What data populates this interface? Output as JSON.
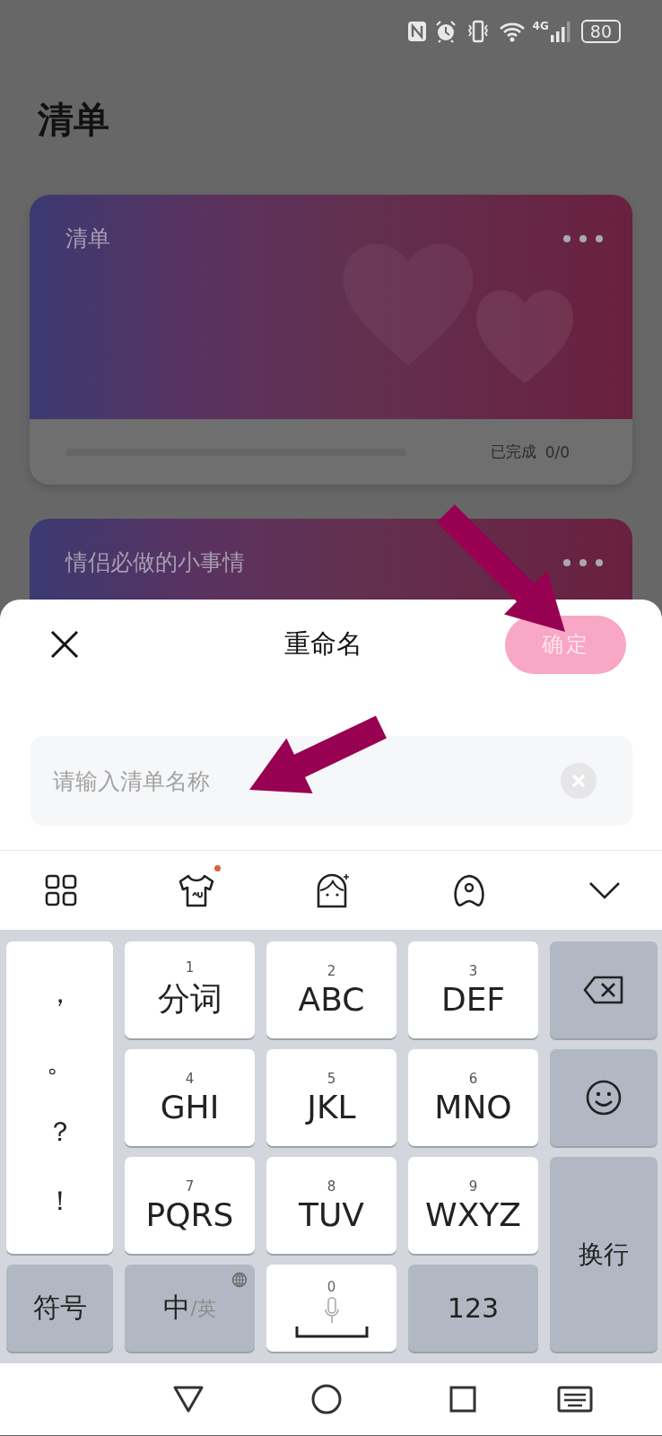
{
  "status_bar": {
    "network": "4G",
    "battery": "80"
  },
  "header": {
    "title": "清单"
  },
  "lists": [
    {
      "title": "清单",
      "progress_label": "已完成",
      "progress": "0/0"
    },
    {
      "title": "情侣必做的小事情"
    }
  ],
  "rename_sheet": {
    "title": "重命名",
    "confirm": {
      "label": "确定",
      "disabled": true
    },
    "field": {
      "placeholder": "请输入清单名称"
    }
  },
  "keyboard_toolbar": [
    {
      "kind": "grid"
    },
    {
      "kind": "shirt",
      "badge": true
    },
    {
      "kind": "face"
    },
    {
      "kind": "assistant"
    },
    {
      "kind": "collapse"
    }
  ],
  "keyboard": {
    "punctuation": [
      "，",
      "。",
      "？",
      "！"
    ],
    "keys": [
      {
        "digit": "1",
        "label": "分词"
      },
      {
        "digit": "2",
        "label": "ABC"
      },
      {
        "digit": "3",
        "label": "DEF"
      },
      {
        "digit": "4",
        "label": "GHI"
      },
      {
        "digit": "5",
        "label": "JKL"
      },
      {
        "digit": "6",
        "label": "MNO"
      },
      {
        "digit": "7",
        "label": "PQRS"
      },
      {
        "digit": "8",
        "label": "TUV"
      },
      {
        "digit": "9",
        "label": "WXYZ"
      }
    ],
    "enter": "换行",
    "symbols": "符号",
    "lang_main": "中",
    "lang_alt": "/英",
    "space_digit": "0",
    "numbers": "123"
  }
}
